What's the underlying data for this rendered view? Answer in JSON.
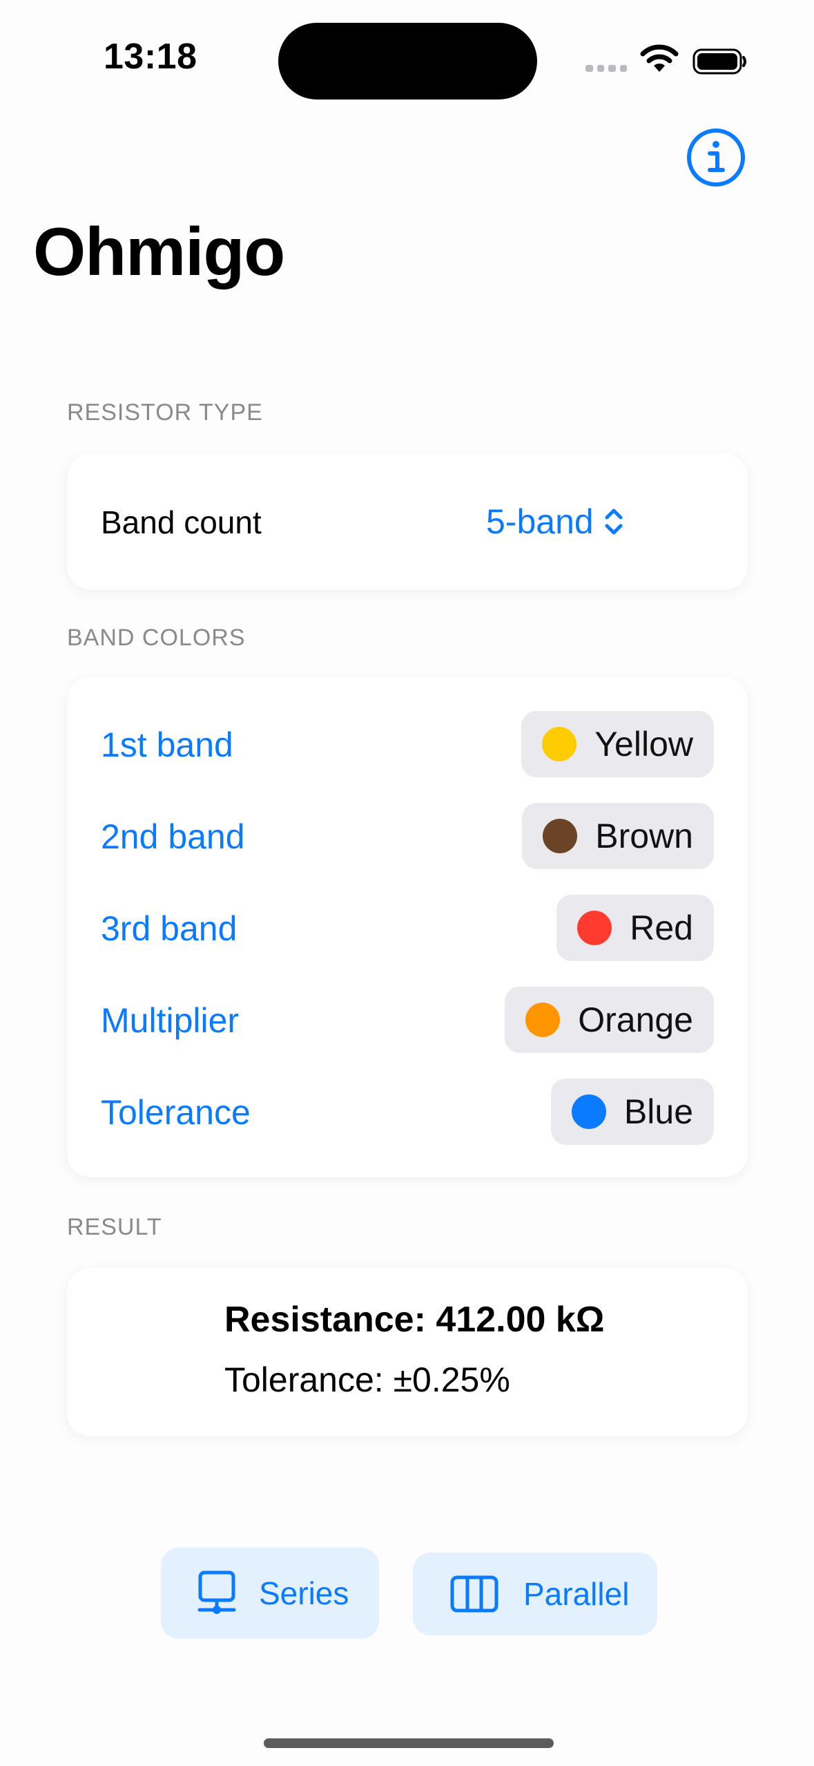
{
  "status_bar": {
    "time": "13:18"
  },
  "app": {
    "title": "Ohmigo",
    "info_icon": "info-circle-icon"
  },
  "resistor_type": {
    "header": "RESISTOR TYPE",
    "band_count_label": "Band count",
    "band_count_value": "5-band"
  },
  "band_colors": {
    "header": "BAND COLORS",
    "rows": [
      {
        "label": "1st band",
        "color_name": "Yellow",
        "color": "#FFCC02"
      },
      {
        "label": "2nd band",
        "color_name": "Brown",
        "color": "#6B4326"
      },
      {
        "label": "3rd band",
        "color_name": "Red",
        "color": "#FF3B30"
      },
      {
        "label": "Multiplier",
        "color_name": "Orange",
        "color": "#FF9500"
      },
      {
        "label": "Tolerance",
        "color_name": "Blue",
        "color": "#0A7AFF"
      }
    ]
  },
  "result": {
    "header": "RESULT",
    "resistance": "Resistance: 412.00 kΩ",
    "tolerance": "Tolerance: ±0.25%"
  },
  "bottom_actions": {
    "series_label": "Series",
    "series_icon": "series-circuit-icon",
    "parallel_label": "Parallel",
    "parallel_icon": "parallel-circuit-icon"
  },
  "colors": {
    "accent": "#0A7AFF",
    "secondary_text": "#8A8A8E",
    "pill_bg": "#E9E9EE",
    "button_bg": "#E3F0FD"
  }
}
